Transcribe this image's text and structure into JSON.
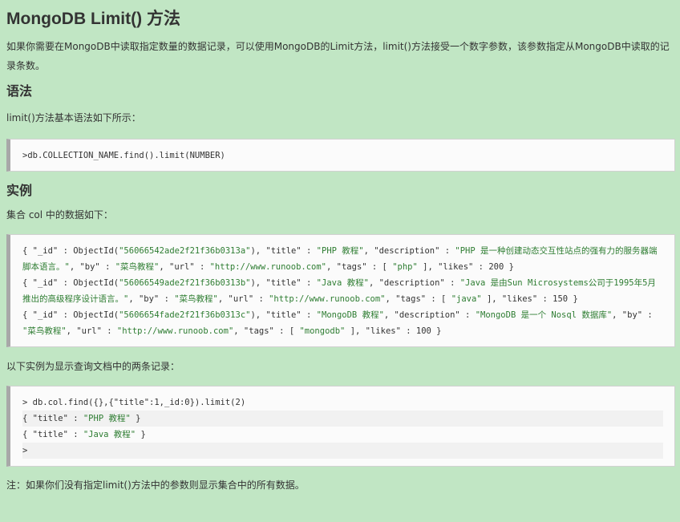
{
  "title": "MongoDB Limit() 方法",
  "intro": "如果你需要在MongoDB中读取指定数量的数据记录，可以使用MongoDB的Limit方法，limit()方法接受一个数字参数，该参数指定从MongoDB中读取的记录条数。",
  "syntax": {
    "heading": "语法",
    "desc": "limit()方法基本语法如下所示：",
    "code": ">db.COLLECTION_NAME.find().limit(NUMBER)"
  },
  "example": {
    "heading": "实例",
    "desc": "集合 col 中的数据如下：",
    "docs": [
      {
        "p1": "{ \"_id\" : ObjectId(",
        "id": "\"56066542ade2f21f36b0313a\"",
        "p2": "), \"title\" : ",
        "title": "\"PHP 教程\"",
        "p3": ", \"description\" : ",
        "description": "\"PHP 是一种创建动态交互性站点的强有力的服务器端脚本语言。\"",
        "p4": ", \"by\" : ",
        "by": "\"菜鸟教程\"",
        "p5": ", \"url\" : ",
        "url": "\"http://www.runoob.com\"",
        "p6": ", \"tags\" : [ ",
        "tag": "\"php\"",
        "p7": " ], \"likes\" : ",
        "likes": "200",
        "p8": " }"
      },
      {
        "p1": "{ \"_id\" : ObjectId(",
        "id": "\"56066549ade2f21f36b0313b\"",
        "p2": "), \"title\" : ",
        "title": "\"Java 教程\"",
        "p3": ", \"description\" : ",
        "description": "\"Java 是由Sun Microsystems公司于1995年5月推出的高级程序设计语言。\"",
        "p4": ", \"by\" : ",
        "by": "\"菜鸟教程\"",
        "p5": ", \"url\" : ",
        "url": "\"http://www.runoob.com\"",
        "p6": ", \"tags\" : [ ",
        "tag": "\"java\"",
        "p7": " ], \"likes\" : ",
        "likes": "150",
        "p8": " }"
      },
      {
        "p1": "{ \"_id\" : ObjectId(",
        "id": "\"5606654fade2f21f36b0313c\"",
        "p2": "), \"title\" : ",
        "title": "\"MongoDB 教程\"",
        "p3": ", \"description\" : ",
        "description": "\"MongoDB 是一个 Nosql 数据库\"",
        "p4": ", \"by\" : ",
        "by": "\"菜鸟教程\"",
        "p5": ", \"url\" : ",
        "url": "\"http://www.runoob.com\"",
        "p6": ", \"tags\" : [ ",
        "tag": "\"mongodb\"",
        "p7": " ], \"likes\" : ",
        "likes": "100",
        "p8": " }"
      }
    ]
  },
  "query": {
    "desc": "以下实例为显示查询文档中的两条记录：",
    "command": "> db.col.find({},{\"title\":1,_id:0}).limit(2)",
    "results": [
      {
        "pre": "{ \"title\" : ",
        "value": "\"PHP 教程\"",
        "post": " }"
      },
      {
        "pre": "{ \"title\" : ",
        "value": "\"Java 教程\"",
        "post": " }"
      }
    ],
    "prompt": ">"
  },
  "note": "注：如果你们没有指定limit()方法中的参数则显示集合中的所有数据。"
}
